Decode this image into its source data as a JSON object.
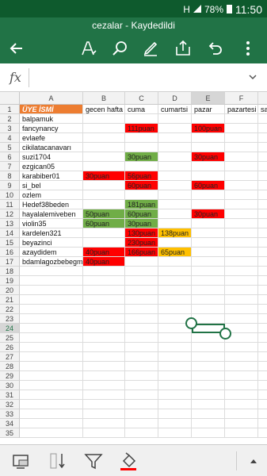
{
  "status": {
    "battery": "78%",
    "time": "11:50",
    "signal": "H"
  },
  "title": "cezalar - Kaydedildi",
  "toolbar": {
    "icons": [
      "back-arrow-icon",
      "pen-format-icon",
      "search-icon",
      "draw-pen-icon",
      "share-icon",
      "undo-icon",
      "more-icon"
    ]
  },
  "formula": {
    "fx": "fx",
    "value": ""
  },
  "columns": [
    "A",
    "B",
    "C",
    "D",
    "E",
    "F",
    "G"
  ],
  "selected_column": "E",
  "selected_row": "24",
  "rows": [
    "1",
    "2",
    "3",
    "4",
    "5",
    "6",
    "7",
    "8",
    "9",
    "10",
    "11",
    "12",
    "13",
    "14",
    "15",
    "16",
    "17",
    "18",
    "19",
    "20",
    "21",
    "22",
    "23",
    "24",
    "25",
    "26",
    "27",
    "28",
    "29",
    "30",
    "31",
    "32",
    "33",
    "34",
    "35"
  ],
  "cells": {
    "r1": [
      "ÜYE İSMİ",
      "gecen hafta",
      "cuma",
      "cumartsi",
      "pazar",
      "pazartesi",
      "sa"
    ],
    "r2": [
      "balpamuk",
      "",
      "",
      "",
      "",
      "",
      ""
    ],
    "r3": [
      "fancynancy",
      "",
      "111puan",
      "",
      "100puan",
      "",
      ""
    ],
    "r4": [
      "evlaefe",
      "",
      "",
      "",
      "",
      "",
      ""
    ],
    "r5": [
      "cikilatacanavarı",
      "",
      "",
      "",
      "",
      "",
      ""
    ],
    "r6": [
      "suzi1704",
      "",
      "30puan",
      "",
      "30puan",
      "",
      ""
    ],
    "r7": [
      "ezgican05",
      "",
      "",
      "",
      "",
      "",
      ""
    ],
    "r8": [
      "karabiber01",
      "30puan",
      "56puan",
      "",
      "",
      "",
      ""
    ],
    "r9": [
      "si_bel",
      "",
      "60puan",
      "",
      "60puan",
      "",
      ""
    ],
    "r10": [
      "ozlem",
      "",
      "",
      "",
      "",
      "",
      ""
    ],
    "r11": [
      "Hedef38beden",
      "",
      "181puan",
      "",
      "",
      "",
      ""
    ],
    "r12": [
      "hayalalemiveben",
      "50puan",
      "60puan",
      "",
      "30puan",
      "",
      ""
    ],
    "r13": [
      "violin35",
      "60puan",
      "30puan",
      "",
      "",
      "",
      ""
    ],
    "r14": [
      "kardelen321",
      "",
      "130puan",
      "138puan",
      "",
      "",
      ""
    ],
    "r15": [
      "beyazinci",
      "",
      "230puan",
      "",
      "",
      "",
      ""
    ],
    "r16": [
      "azaydidem",
      "40puan",
      "166puan",
      "65puan",
      "",
      "",
      ""
    ],
    "r17": [
      "bdamlagozbebegm",
      "40puan",
      "",
      "",
      "",
      "",
      ""
    ]
  },
  "colors": {
    "header_orange": "#ed7d31",
    "red": "#ff0000",
    "green": "#70ad47",
    "yellow": "#ffc000",
    "excel_green": "#217346"
  },
  "fills": {
    "r1": [
      "orange",
      "",
      "",
      "",
      "",
      "",
      ""
    ],
    "r3": [
      "",
      "",
      "red",
      "",
      "red",
      "",
      ""
    ],
    "r6": [
      "",
      "",
      "green",
      "",
      "red",
      "",
      ""
    ],
    "r8": [
      "",
      "red",
      "red",
      "",
      "",
      "",
      ""
    ],
    "r9": [
      "",
      "",
      "red",
      "",
      "red",
      "",
      ""
    ],
    "r11": [
      "",
      "",
      "green",
      "",
      "",
      "",
      ""
    ],
    "r12": [
      "",
      "green",
      "green",
      "",
      "red",
      "",
      ""
    ],
    "r13": [
      "",
      "green",
      "green",
      "",
      "",
      "",
      ""
    ],
    "r14": [
      "",
      "",
      "red",
      "yellow",
      "",
      "",
      ""
    ],
    "r15": [
      "",
      "",
      "red",
      "",
      "",
      "",
      ""
    ],
    "r16": [
      "",
      "red",
      "red",
      "yellow",
      "",
      "",
      ""
    ],
    "r17": [
      "",
      "red",
      "",
      "",
      "",
      "",
      ""
    ]
  },
  "bottom_icons": [
    "sheets-view-icon",
    "sort-icon",
    "filter-icon",
    "fill-color-icon",
    "expand-up-icon"
  ]
}
